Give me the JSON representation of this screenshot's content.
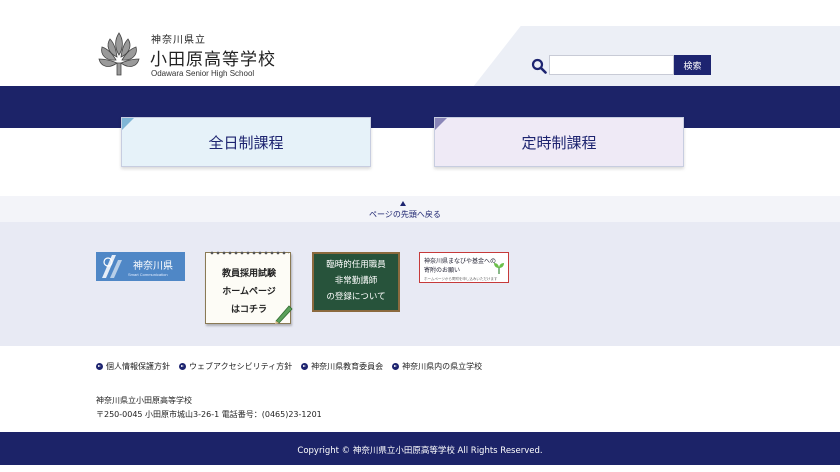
{
  "header": {
    "prefecture": "神奈川県立",
    "school_name": "小田原高等学校",
    "school_name_en": "Odawara Senior High School",
    "logo_icon": "school-crest-icon"
  },
  "search": {
    "placeholder": "",
    "button_label": "検索",
    "icon": "search-icon"
  },
  "courses": {
    "fulltime_label": "全日制課程",
    "parttime_label": "定時制課程"
  },
  "page_top": {
    "label": "ページの先頭へ戻る"
  },
  "banners": {
    "kanagawa": {
      "label": "神奈川県",
      "sub": "Smart Communication"
    },
    "teacher_recruit": {
      "line1": "教員採用試験",
      "line2": "ホームページ",
      "line3": "はコチラ"
    },
    "temp_staff": {
      "line1": "臨時的任用職員",
      "line2": "非常勤講師",
      "line3": "の登録について"
    },
    "fund": {
      "line1": "神奈川県まなびや基金への",
      "line2": "寄附のお願い",
      "small": "ホームページから寄附を申し込みいただけます"
    }
  },
  "footer": {
    "links": [
      "個人情報保護方針",
      "ウェブアクセシビリティ方針",
      "神奈川県教育委員会",
      "神奈川県内の県立学校"
    ],
    "address_name": "神奈川県立小田原高等学校",
    "address_line": "〒250-0045 小田原市城山3-26-1 電話番号：(0465)23-1201",
    "copyright": "Copyright © 神奈川県立小田原高等学校 All Rights Reserved."
  },
  "colors": {
    "navy": "#1c2368",
    "fulltime_card": "#e6f2f9",
    "parttime_card": "#efeaf6",
    "banner_area": "#e8eaf4"
  }
}
